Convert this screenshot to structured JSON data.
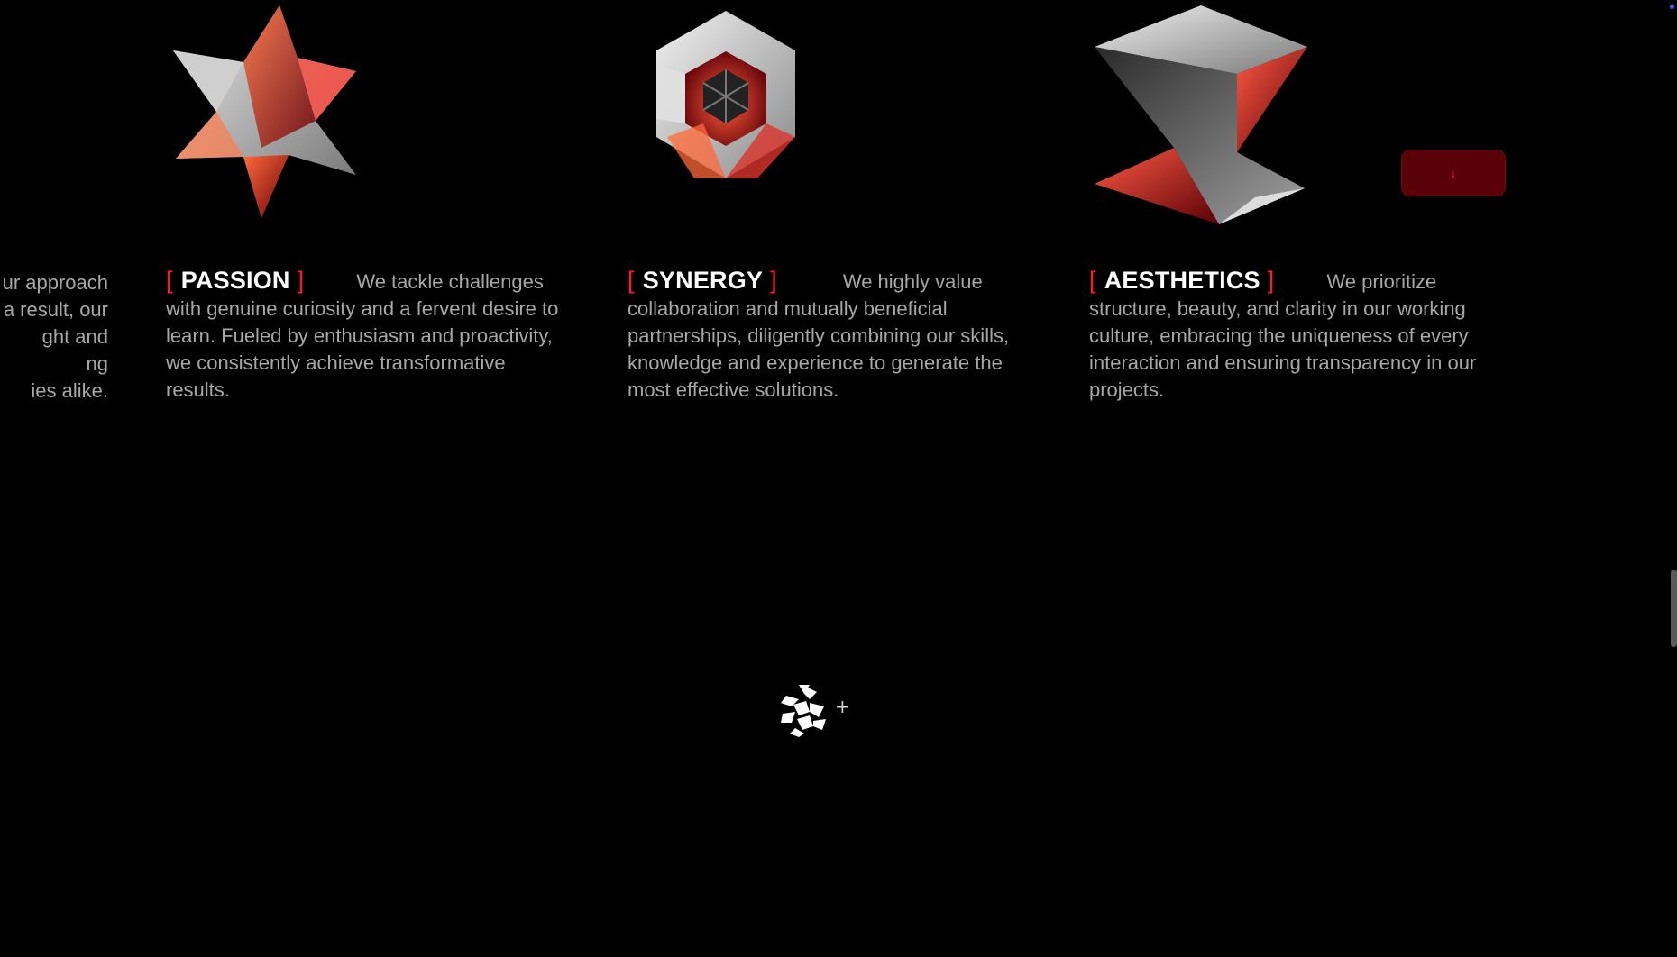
{
  "values": [
    {
      "title": "PASSION",
      "text": "We tackle challenges with genuine curiosity and a fervent desire to learn. Fueled by enthusiasm and proactivity, we consistently achieve transformative results."
    },
    {
      "title": "SYNERGY",
      "text": "We highly value collaboration and mutually beneficial partnerships, diligently combining our skills, knowledge and experience to generate the most effective solutions."
    },
    {
      "title": "AESTHETICS",
      "text": "We prioritize structure, beauty, and clarity in our working culture, embracing the uniqueness of every interaction and ensuring transparency in our projects."
    }
  ],
  "brackets": {
    "open": "[",
    "close": "]"
  },
  "cut_off_text": {
    "lines": [
      "ur approach",
      "a result, our",
      "ght and",
      "ng",
      "ies alike."
    ]
  },
  "down_button": {
    "icon": "arrow-down-icon",
    "glyph": "↓"
  },
  "footer": {
    "logo_icon": "brand-logo-icon",
    "plus_glyph": "+"
  },
  "colors": {
    "accent": "#ff1a2b",
    "button_bg": "#5a0008",
    "background": "#000000",
    "heading": "#ffffff",
    "body_text": "#a7a7a7"
  }
}
